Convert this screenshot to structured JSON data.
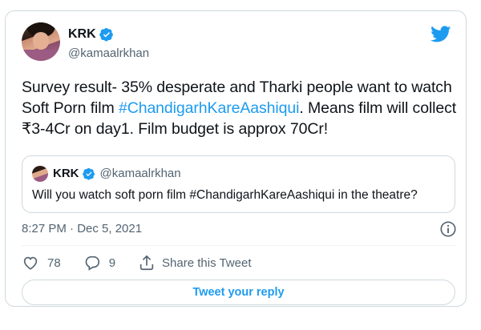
{
  "author": {
    "display_name": "KRK",
    "handle": "@kamaalrkhan"
  },
  "tweet": {
    "text_before": "Survey result- 35% desperate and Tharki people want to watch Soft Porn film ",
    "hashtag": "#ChandigarhKareAashiqui",
    "text_after": ". Means film will collect ₹3-4Cr on day1. Film budget is approx 70Cr!",
    "timestamp": "8:27 PM · Dec 5, 2021"
  },
  "quoted_tweet": {
    "display_name": "KRK",
    "handle": "@kamaalrkhan",
    "text": "Will you watch soft porn film #ChandigarhKareAashiqui in the theatre?"
  },
  "actions": {
    "like_count": "78",
    "reply_count": "9",
    "share_label": "Share this Tweet"
  },
  "reply_button_label": "Tweet your reply",
  "colors": {
    "accent": "#1d9bf0",
    "text": "#0f1419",
    "secondary": "#536471",
    "border": "#cfd9de"
  },
  "icons": [
    "verified-badge-icon",
    "twitter-bird-icon",
    "info-icon",
    "heart-icon",
    "reply-bubble-icon",
    "share-icon"
  ]
}
